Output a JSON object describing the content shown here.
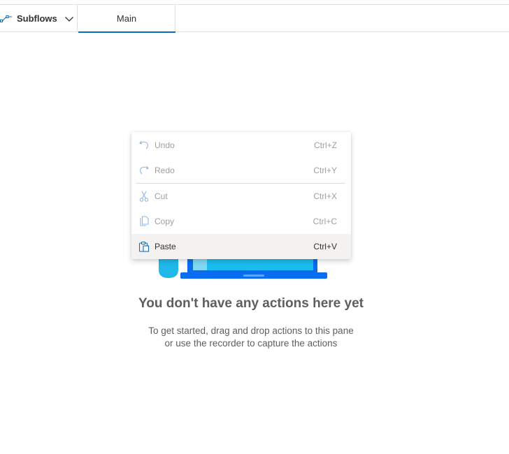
{
  "tabs": {
    "subflows_label": "Subflows",
    "main_label": "Main"
  },
  "empty_state": {
    "title": "You don't have any actions here yet",
    "subtitle_line1": "To get started, drag and drop actions to this pane",
    "subtitle_line2": "or use the recorder to capture the actions"
  },
  "context_menu": {
    "items": [
      {
        "label": "Undo",
        "shortcut": "Ctrl+Z",
        "icon": "undo-icon",
        "enabled": false
      },
      {
        "label": "Redo",
        "shortcut": "Ctrl+Y",
        "icon": "redo-icon",
        "enabled": false
      },
      {
        "label": "Cut",
        "shortcut": "Ctrl+X",
        "icon": "cut-icon",
        "enabled": false
      },
      {
        "label": "Copy",
        "shortcut": "Ctrl+C",
        "icon": "copy-icon",
        "enabled": false
      },
      {
        "label": "Paste",
        "shortcut": "Ctrl+V",
        "icon": "paste-icon",
        "enabled": true
      }
    ]
  },
  "colors": {
    "accent": "#0f6cbd",
    "disabled_text": "#a19f9d",
    "hover_bg": "#f3f2f1",
    "illustration_blue": "#0a6cf0",
    "illustration_cyan": "#1fb8e8"
  }
}
